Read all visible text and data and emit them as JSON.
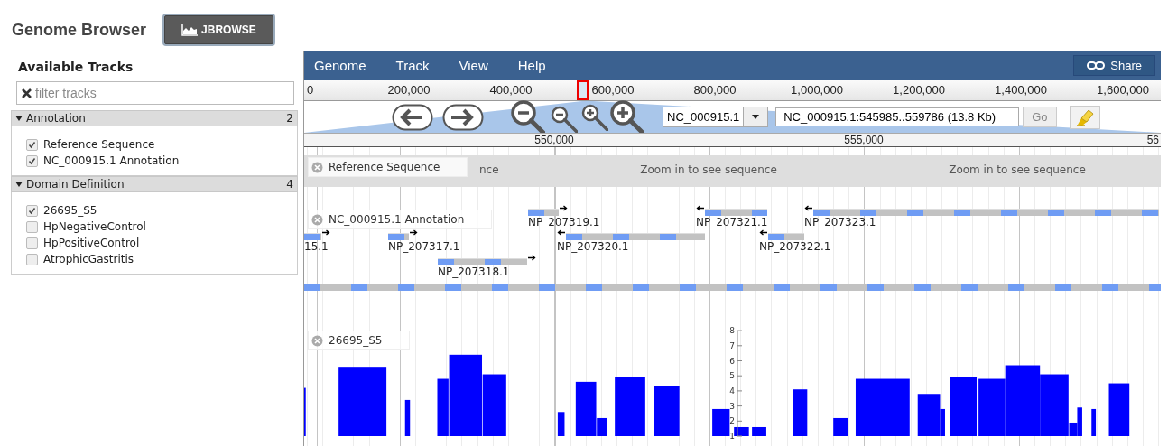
{
  "header": {
    "title": "Genome Browser",
    "button": "JBROWSE"
  },
  "sidebar": {
    "title": "Available Tracks",
    "filter": {
      "placeholder": "filter tracks"
    },
    "categories": [
      {
        "name": "Annotation",
        "count": "2",
        "expanded": true,
        "tracks": [
          {
            "label": "Reference Sequence",
            "checked": true
          },
          {
            "label": "NC_000915.1 Annotation",
            "checked": true
          }
        ]
      },
      {
        "name": "Domain Definition",
        "count": "4",
        "expanded": true,
        "tracks": [
          {
            "label": "26695_S5",
            "checked": true
          },
          {
            "label": "HpNegativeControl",
            "checked": false
          },
          {
            "label": "HpPositiveControl",
            "checked": false
          },
          {
            "label": "AtrophicGastritis",
            "checked": false
          }
        ]
      }
    ]
  },
  "browser": {
    "menu": [
      "Genome",
      "Track",
      "View",
      "Help"
    ],
    "share": "Share",
    "overview_ticks": [
      "0",
      "200,000",
      "400,000",
      "600,000",
      "800,000",
      "1,000,000",
      "1,200,000",
      "1,400,000",
      "1,600,000"
    ],
    "nav": {
      "ref_seq": "NC_000915.1",
      "location": "NC_000915.1:545985..559786 (13.8 Kb)",
      "go": "Go"
    },
    "detail_ticks": [
      "550,000",
      "555,000",
      "56"
    ],
    "tracks": [
      {
        "kind": "sequence",
        "label": "Reference Sequence",
        "messages": [
          "nce",
          "Zoom in to see sequence",
          "Zoom in to see sequence"
        ]
      },
      {
        "kind": "features",
        "label": "NC_000915.1 Annotation",
        "features": [
          {
            "label": "NP_207319.1",
            "reverse": false
          },
          {
            "label": "NP_207321.1",
            "reverse": true
          },
          {
            "label": "NP_207323.1",
            "reverse": true
          },
          {
            "label": "15.1",
            "reverse": false
          },
          {
            "label": "NP_207317.1",
            "reverse": false
          },
          {
            "label": "NP_207320.1",
            "reverse": true
          },
          {
            "label": "NP_207322.1",
            "reverse": true
          },
          {
            "label": "NP_207318.1",
            "reverse": false
          }
        ]
      },
      {
        "kind": "coverage",
        "label": "26695_S5",
        "axis_labels": [
          "8",
          "7",
          "6",
          "5",
          "4",
          "3",
          "2",
          "1"
        ]
      }
    ]
  }
}
